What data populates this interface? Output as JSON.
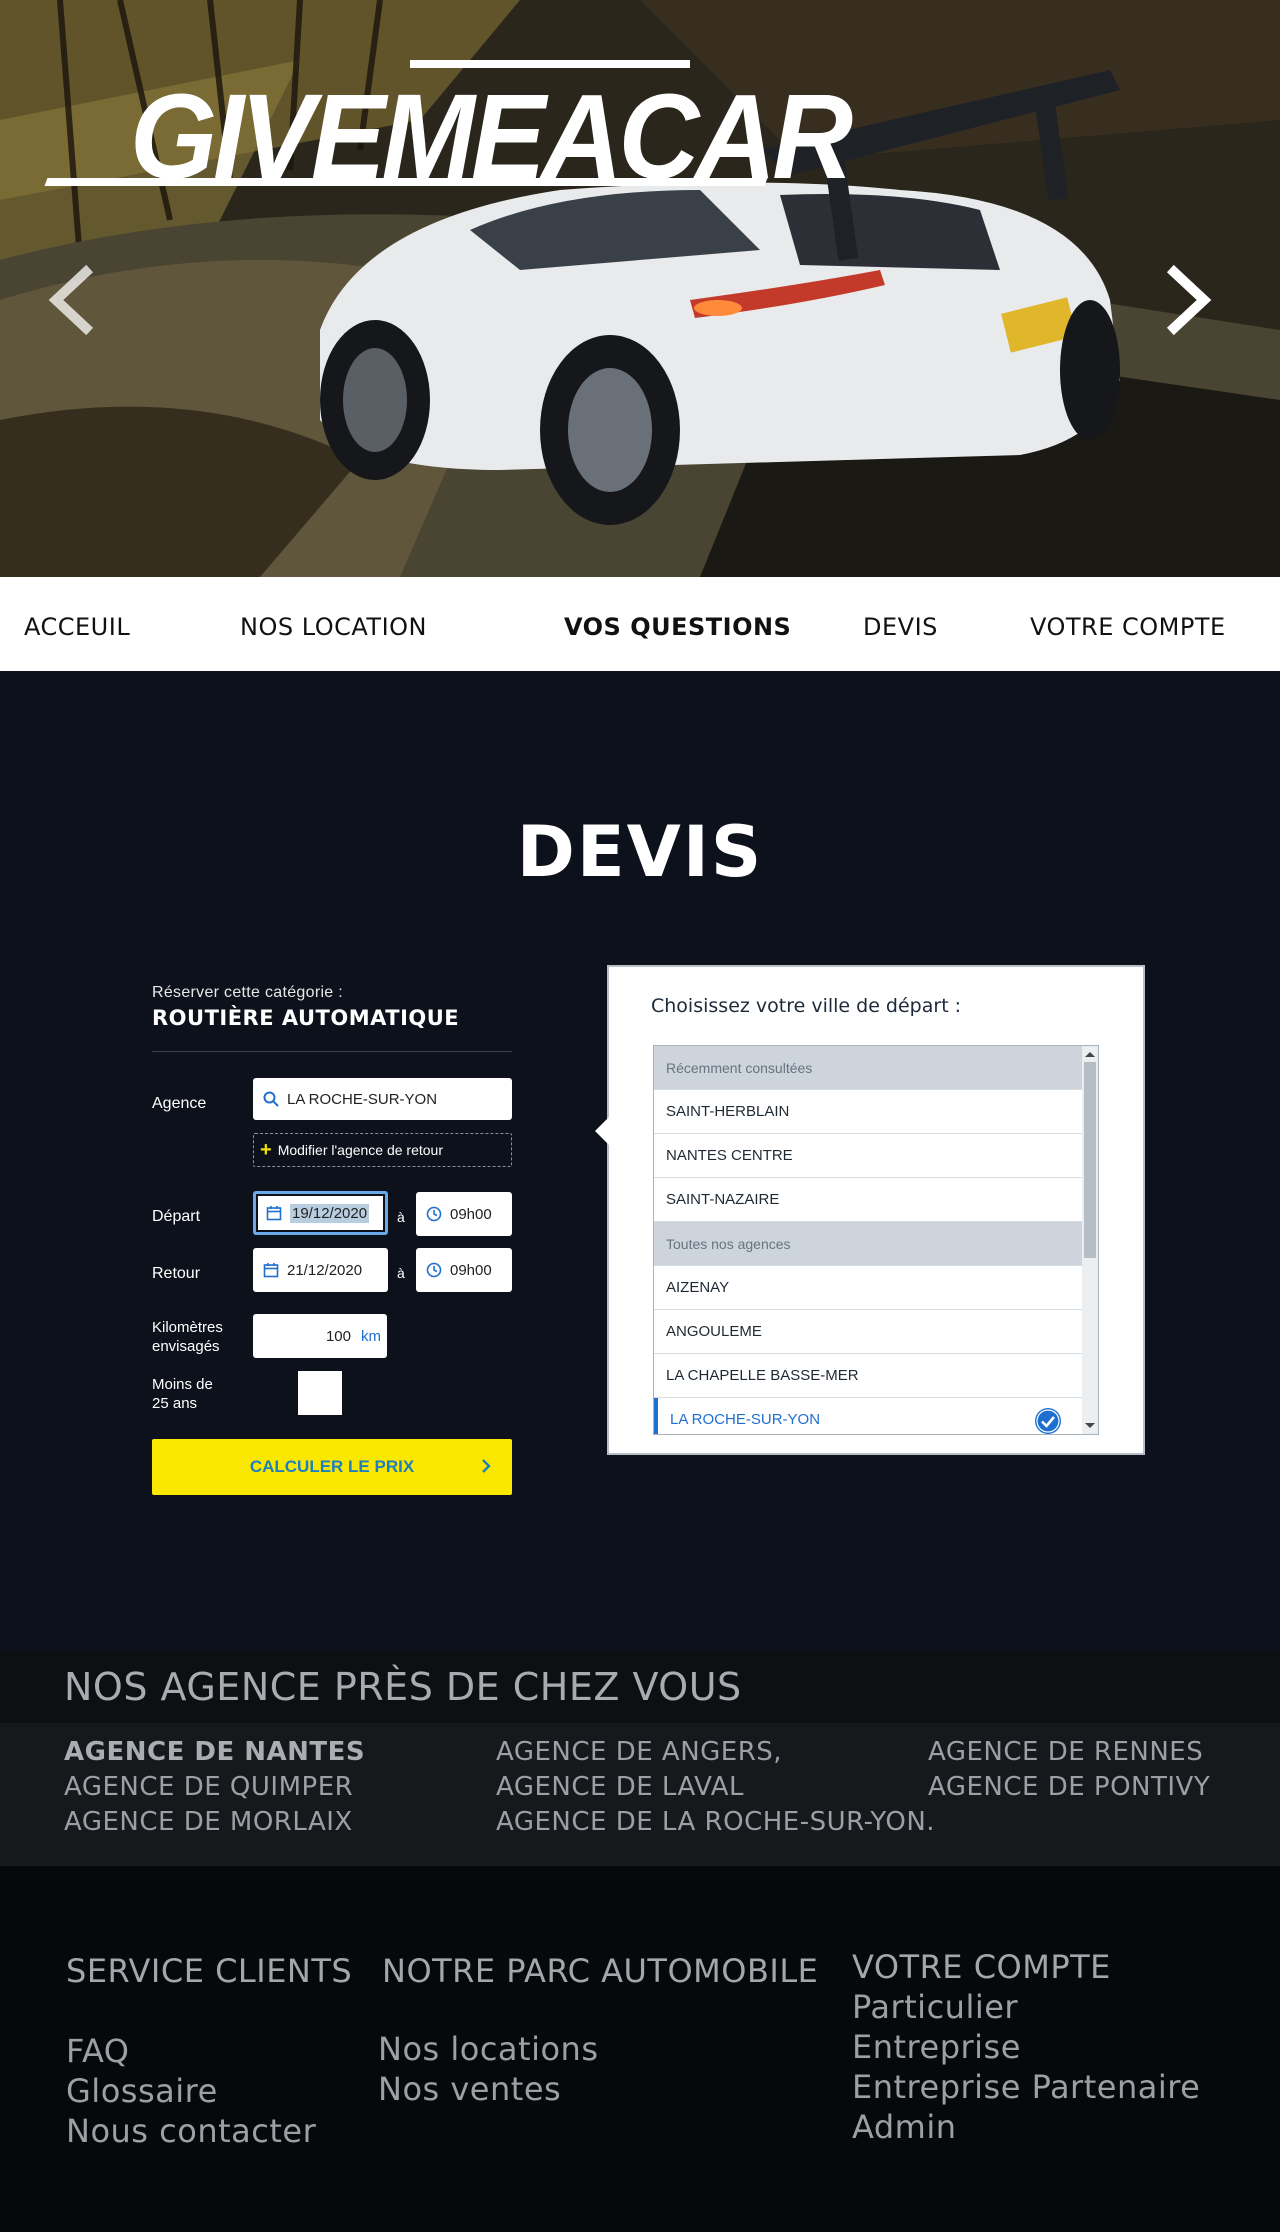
{
  "hero": {
    "logo": "GIVEMEACAR",
    "prev_icon": "chevron-left-icon",
    "next_icon": "chevron-right-icon"
  },
  "nav": {
    "items": [
      {
        "label": "ACCEUIL"
      },
      {
        "label": "NOS LOCATION"
      },
      {
        "label": "VOS QUESTIONS",
        "active": true
      },
      {
        "label": "DEVIS"
      },
      {
        "label": "VOTRE COMPTE"
      }
    ]
  },
  "devis": {
    "title": "DEVIS",
    "category_label": "Réserver cette catégorie :",
    "category_value": "ROUTIÈRE AUTOMATIQUE",
    "agence_label": "Agence",
    "agence_value": "LA ROCHE-SUR-YON",
    "modify_return": "Modifier l'agence de retour",
    "depart_label": "Départ",
    "depart_date": "19/12/2020",
    "depart_time": "09h00",
    "retour_label": "Retour",
    "retour_date": "21/12/2020",
    "retour_time": "09h00",
    "a_label": "à",
    "km_label_1": "Kilomètres",
    "km_label_2": "envisagés",
    "km_value": "100",
    "km_unit": "km",
    "age_label_1": "Moins de",
    "age_label_2": "25 ans",
    "age_checked": false,
    "calc_button": "CALCULER LE PRIX",
    "accent_color": "#fae800",
    "link_color": "#1e6fcf"
  },
  "city_picker": {
    "title": "Choisissez votre ville de départ :",
    "items": [
      {
        "label": "Récemment consultées",
        "group": true
      },
      {
        "label": "SAINT-HERBLAIN"
      },
      {
        "label": "NANTES CENTRE"
      },
      {
        "label": "SAINT-NAZAIRE"
      },
      {
        "label": "Toutes nos agences",
        "group": true
      },
      {
        "label": "AIZENAY"
      },
      {
        "label": "ANGOULEME"
      },
      {
        "label": "LA CHAPELLE BASSE-MER"
      },
      {
        "label": "LA ROCHE-SUR-YON",
        "selected": true
      }
    ]
  },
  "agences": {
    "title": "NOS AGENCE PRÈS DE CHEZ VOUS",
    "col1": [
      "AGENCE DE NANTES",
      "AGENCE DE QUIMPER",
      "AGENCE DE MORLAIX"
    ],
    "col2": [
      "AGENCE DE ANGERS,",
      "AGENCE DE LAVAL",
      "AGENCE DE LA ROCHE-SUR-YON."
    ],
    "col3": [
      "AGENCE DE RENNES",
      "AGENCE DE PONTIVY"
    ]
  },
  "footer": {
    "service": {
      "title": "SERVICE CLIENTS",
      "links": [
        "FAQ",
        "Glossaire",
        "Nous contacter"
      ]
    },
    "parc": {
      "title": "NOTRE PARC AUTOMOBILE",
      "links": [
        "Nos locations",
        "Nos ventes"
      ]
    },
    "compte": {
      "title": "VOTRE COMPTE",
      "links": [
        "Particulier",
        "Entreprise",
        "Entreprise Partenaire",
        "Admin"
      ]
    }
  }
}
